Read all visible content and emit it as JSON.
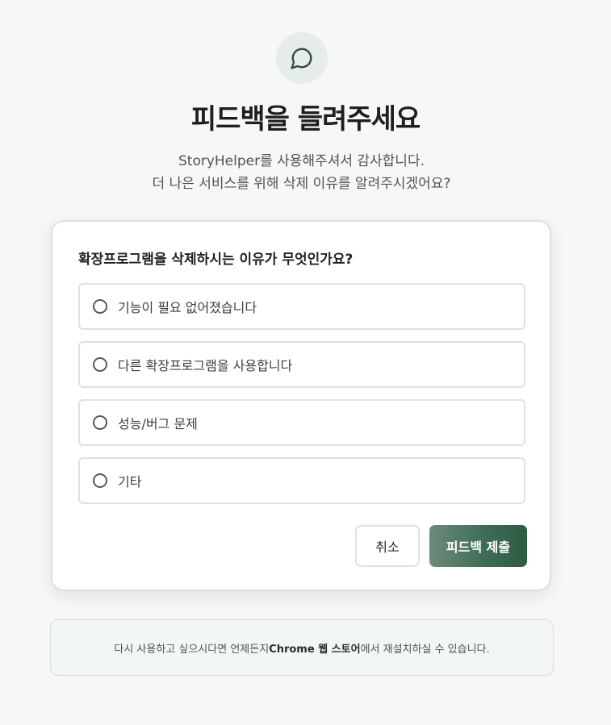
{
  "header": {
    "icon": "chat-bubble-icon",
    "title": "피드백을 들려주세요",
    "subtitle_line1": "StoryHelper를 사용해주셔서 감사합니다.",
    "subtitle_line2": "더 나은 서비스를 위해 삭제 이유를 알려주시겠어요?"
  },
  "form": {
    "question": "확장프로그램을 삭제하시는 이유가 무엇인가요?",
    "options": [
      {
        "label": "기능이 필요 없어졌습니다",
        "selected": false
      },
      {
        "label": "다른 확장프로그램을 사용합니다",
        "selected": false
      },
      {
        "label": "성능/버그 문제",
        "selected": false
      },
      {
        "label": "기타",
        "selected": false
      }
    ],
    "cancel_label": "취소",
    "submit_label": "피드백 제출"
  },
  "footer": {
    "prefix": "다시 사용하고 싶으시다면 언제든지 ",
    "store_name": "Chrome 웹 스토어",
    "suffix": "에서 재설치하실 수 있습니다."
  },
  "colors": {
    "accent": "#3f6e56",
    "background": "#f6f7f6",
    "icon_circle": "#e6ece8"
  }
}
